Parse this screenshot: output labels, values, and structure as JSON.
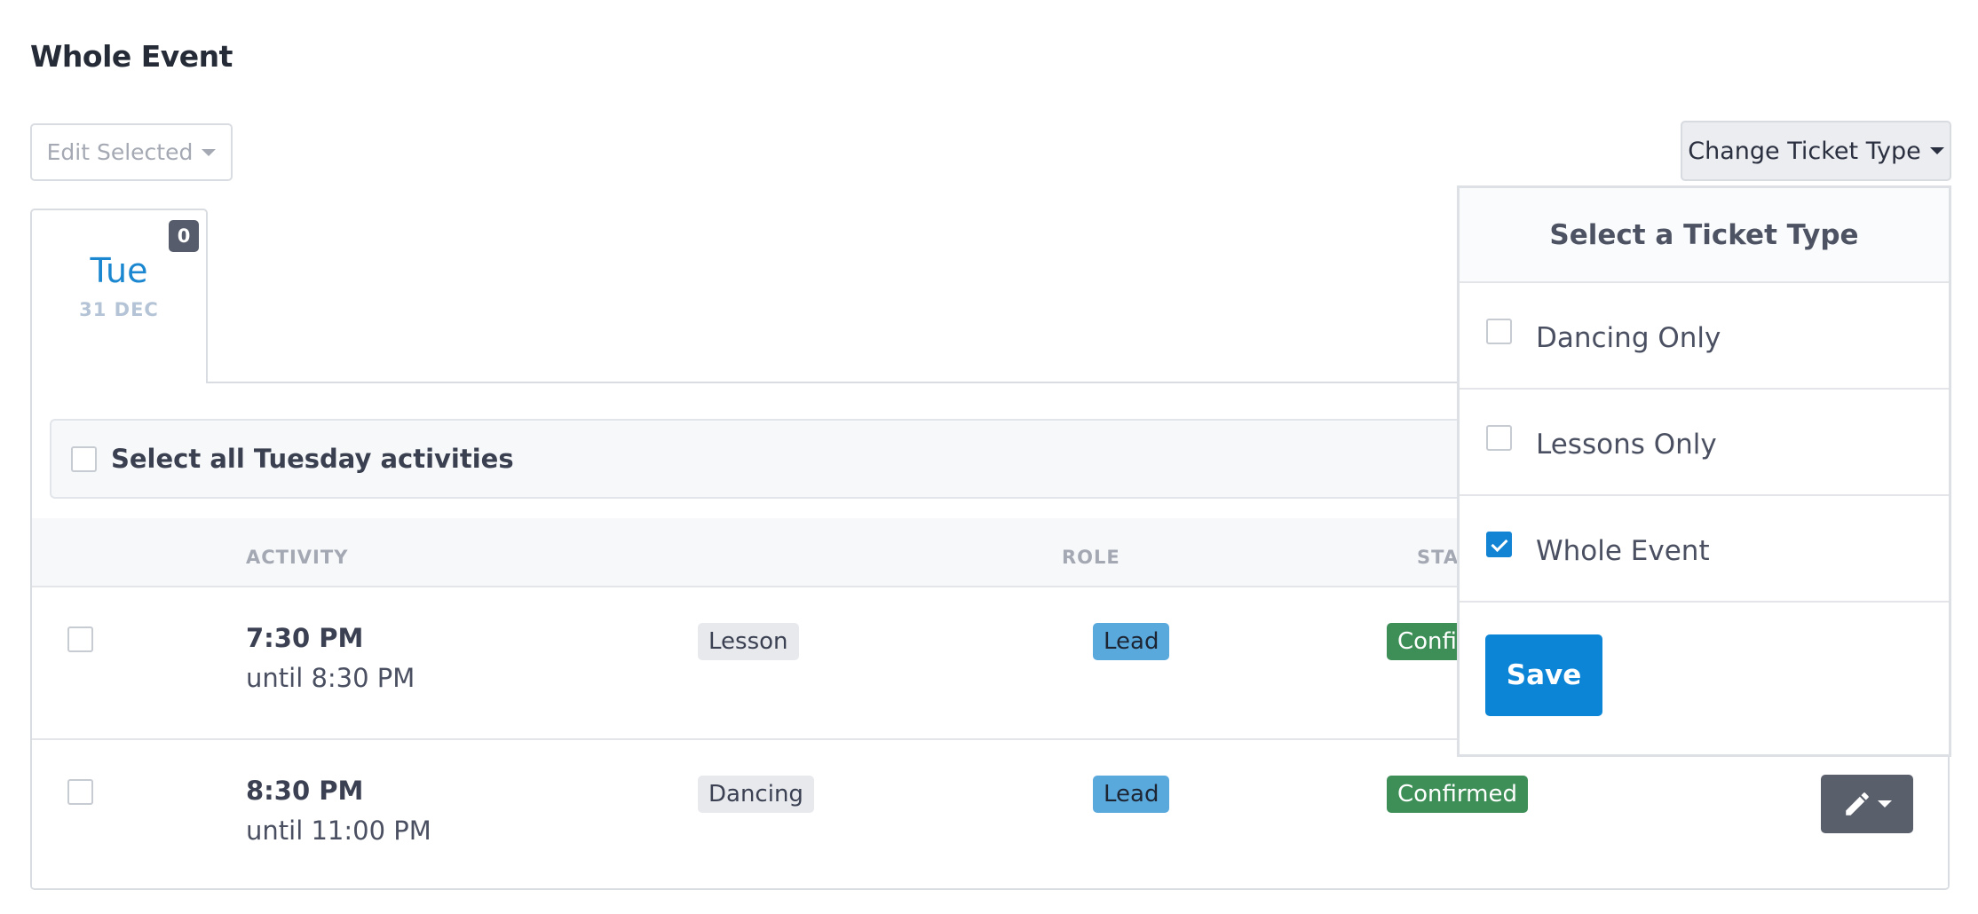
{
  "page": {
    "title": "Whole Event"
  },
  "toolbar": {
    "edit_selected_label": "Edit Selected",
    "change_ticket_label": "Change Ticket Type"
  },
  "day_tab": {
    "day": "Tue",
    "date": "31 DEC",
    "count": "0"
  },
  "select_all": {
    "label": "Select all Tuesday activities",
    "checked": false
  },
  "table": {
    "headers": {
      "activity": "ACTIVITY",
      "role": "ROLE",
      "status": "STA"
    },
    "rows": [
      {
        "time": "7:30 PM",
        "until": "until 8:30 PM",
        "activity": "Lesson",
        "role": "Lead",
        "status": "Confirmed",
        "status_visible": "Confi"
      },
      {
        "time": "8:30 PM",
        "until": "until 11:00 PM",
        "activity": "Dancing",
        "role": "Lead",
        "status": "Confirmed",
        "status_visible": "Confirmed"
      }
    ]
  },
  "ticket_dropdown": {
    "header": "Select a Ticket Type",
    "options": [
      {
        "label": "Dancing Only",
        "checked": false
      },
      {
        "label": "Lessons Only",
        "checked": false
      },
      {
        "label": "Whole Event",
        "checked": true
      }
    ],
    "save_label": "Save"
  },
  "colors": {
    "accent": "#0c85d6",
    "role_badge": "#5aa9dd",
    "status_badge": "#3e8f57",
    "day_name": "#1b87d0"
  },
  "icons": {
    "edit": "pencil-icon",
    "dropdown": "caret-down-icon"
  }
}
